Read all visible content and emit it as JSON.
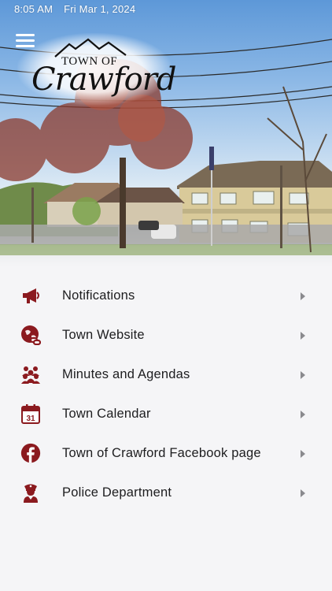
{
  "status_bar": {
    "time": "8:05 AM",
    "date": "Fri Mar 1, 2024"
  },
  "header": {
    "logo_line1": "TOWN OF",
    "logo_line2": "Crawford"
  },
  "colors": {
    "icon_accent": "#8b1a1f",
    "chevron": "#8a8a8e",
    "text": "#1d1d1f"
  },
  "menu": [
    {
      "label": "Notifications",
      "icon": "megaphone-icon"
    },
    {
      "label": "Town Website",
      "icon": "globe-link-icon"
    },
    {
      "label": "Minutes and Agendas",
      "icon": "people-group-icon"
    },
    {
      "label": "Town Calendar",
      "icon": "calendar-icon",
      "icon_text": "31"
    },
    {
      "label": "Town of Crawford Facebook page",
      "icon": "facebook-icon"
    },
    {
      "label": "Police Department",
      "icon": "police-officer-icon"
    }
  ]
}
